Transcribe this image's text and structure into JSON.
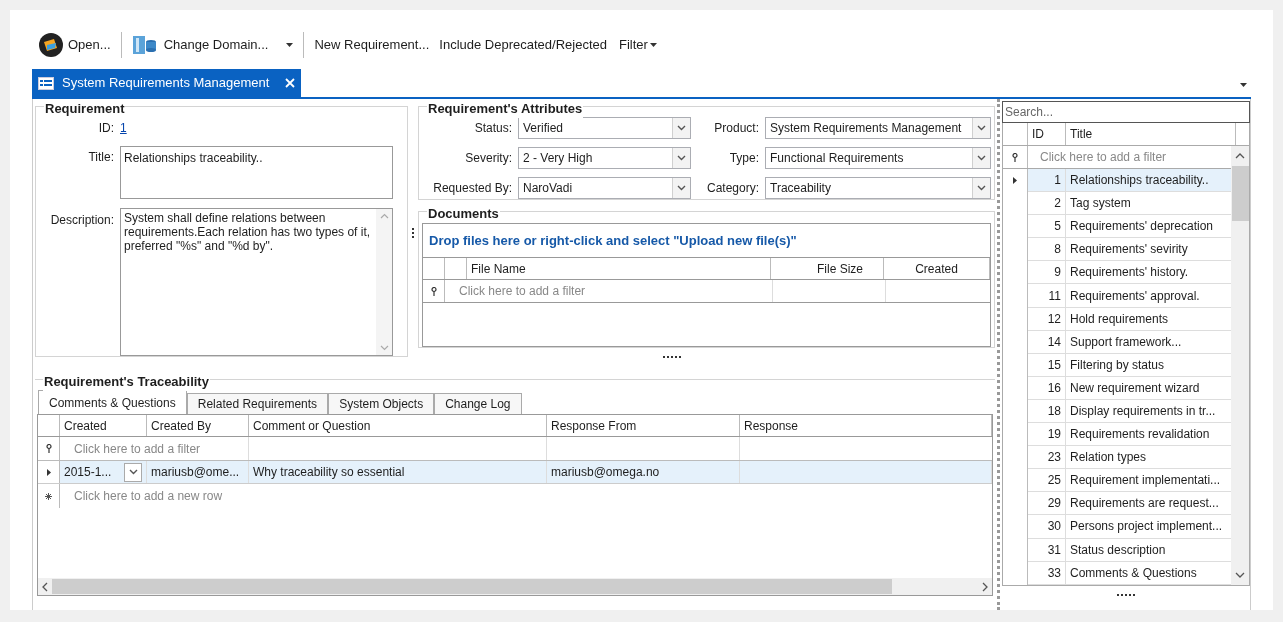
{
  "toolbar": [
    {
      "kind": "open",
      "label": "Open..."
    },
    {
      "kind": "separator"
    },
    {
      "kind": "domain",
      "label": "Change Domain..."
    },
    {
      "kind": "separator"
    },
    {
      "kind": "text",
      "label": "New Requirement..."
    },
    {
      "kind": "text",
      "label": "Include Deprecated/Rejected"
    },
    {
      "kind": "menu",
      "label": "Filter"
    }
  ],
  "document_tabs": [
    {
      "label": "System Requirements Management",
      "selected": true
    }
  ],
  "requirement": {
    "title": "Requirement",
    "id_label": "ID:",
    "id_value": "1",
    "title_label": "Title:",
    "title_value": "Relationships traceability..",
    "description_label": "Description:",
    "description_value": "System shall define relations between requirements.Each relation has two types of it, preferred \"%s\" and \"%d by\"."
  },
  "attributes": {
    "title": "Requirement's Attributes",
    "fields": [
      {
        "label": "Status:",
        "value": "Verified"
      },
      {
        "label": "Product:",
        "value": "System Requirements Management"
      },
      {
        "label": "Severity:",
        "value": "2 - Very High"
      },
      {
        "label": "Type:",
        "value": "Functional Requirements"
      },
      {
        "label": "Requested By:",
        "value": "NaroVadi"
      },
      {
        "label": "Category:",
        "value": "Traceability"
      }
    ]
  },
  "documents": {
    "title": "Documents",
    "drop_hint": "Drop files here or right-click and select \"Upload new file(s)\"",
    "columns": [
      "File Name",
      "File Size",
      "Created"
    ],
    "filter_placeholder": "Click here to add a filter"
  },
  "traceability": {
    "title": "Requirement's Traceability",
    "tabs": [
      {
        "label": "Comments & Questions",
        "selected": true
      },
      {
        "label": "Related Requirements",
        "selected": false
      },
      {
        "label": "System Objects",
        "selected": false
      },
      {
        "label": "Change Log",
        "selected": false
      }
    ],
    "columns": [
      "Created",
      "Created By",
      "Comment or Question",
      "Response From",
      "Response"
    ],
    "filter_placeholder": "Click here to add a filter",
    "rows": [
      {
        "selected": true,
        "cells": [
          "2015-1...",
          "mariusb@ome...",
          "Why traceability so essential",
          "mariusb@omega.no",
          ""
        ]
      }
    ],
    "new_row_placeholder": "Click here to add a new row"
  },
  "requirements_list": {
    "search_placeholder": "Search...",
    "columns": [
      "ID",
      "Title"
    ],
    "filter_placeholder": "Click here to add a filter",
    "rows": [
      {
        "id": "1",
        "title": "Relationships traceability..",
        "selected": true
      },
      {
        "id": "2",
        "title": "Tag system",
        "selected": false
      },
      {
        "id": "5",
        "title": "Requirements' deprecation",
        "selected": false
      },
      {
        "id": "8",
        "title": "Requirements' sevirity",
        "selected": false
      },
      {
        "id": "9",
        "title": "Requirements' history.",
        "selected": false
      },
      {
        "id": "11",
        "title": "Requirements' approval.",
        "selected": false
      },
      {
        "id": "12",
        "title": "Hold requirements",
        "selected": false
      },
      {
        "id": "14",
        "title": "Support framework...",
        "selected": false
      },
      {
        "id": "15",
        "title": "Filtering by status",
        "selected": false
      },
      {
        "id": "16",
        "title": "New requirement wizard",
        "selected": false
      },
      {
        "id": "18",
        "title": "Display requirements in tr...",
        "selected": false
      },
      {
        "id": "19",
        "title": "Requirements revalidation",
        "selected": false
      },
      {
        "id": "23",
        "title": "Relation types",
        "selected": false
      },
      {
        "id": "25",
        "title": "Requirement implementati...",
        "selected": false
      },
      {
        "id": "29",
        "title": "Requirements are request...",
        "selected": false
      },
      {
        "id": "30",
        "title": "Persons project implement...",
        "selected": false
      },
      {
        "id": "31",
        "title": "Status description",
        "selected": false
      },
      {
        "id": "33",
        "title": "Comments & Questions",
        "selected": false
      }
    ]
  }
}
